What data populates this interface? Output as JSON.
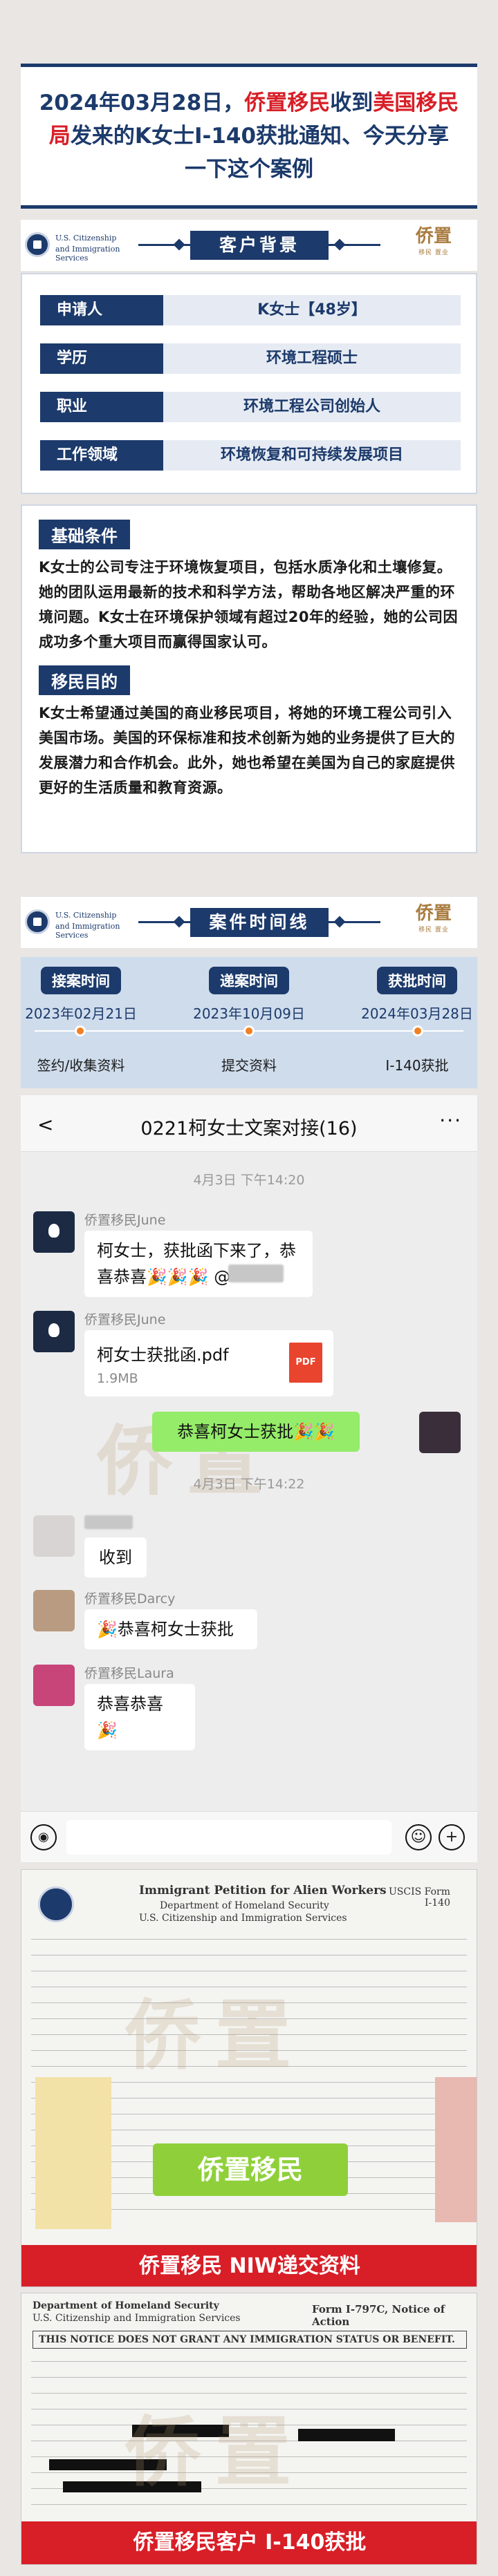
{
  "header": {
    "part1": "2024年03月28日，",
    "part2_red": "侨置移民",
    "part3": "收到",
    "part4_red": "美国移民局",
    "part5": "发来的K女士I-140获批通知、今天分享一下这个案例"
  },
  "logos": {
    "uscis_line1": "U.S. Citizenship",
    "uscis_line2": "and Immigration",
    "uscis_line3": "Services",
    "brand_name": "侨置",
    "brand_sub": "移民 置业"
  },
  "section_background": {
    "title": "客户背景"
  },
  "info": [
    {
      "label": "申请人",
      "value": "K女士【48岁】"
    },
    {
      "label": "学历",
      "value": "环境工程硕士"
    },
    {
      "label": "职业",
      "value": "环境工程公司创始人"
    },
    {
      "label": "工作领域",
      "value": "环境恢复和可持续发展项目"
    }
  ],
  "basic": {
    "label": "基础条件",
    "text": "K女士的公司专注于环境恢复项目，包括水质净化和土壤修复。她的团队运用最新的技术和科学方法，帮助各地区解决严重的环境问题。K女士在环境保护领域有超过20年的经验，她的公司因成功多个重大项目而赢得国家认可。"
  },
  "purpose": {
    "label": "移民目的",
    "text": "K女士希望通过美国的商业移民项目，将她的环境工程公司引入美国市场。美国的环保标准和技术创新为她的业务提供了巨大的发展潜力和合作机会。此外，她也希望在美国为自己的家庭提供更好的生活质量和教育资源。"
  },
  "section_timeline": {
    "title": "案件时间线"
  },
  "timeline": [
    {
      "label": "接案时间",
      "date": "2023年02月21日",
      "step": "签约/收集资料"
    },
    {
      "label": "递案时间",
      "date": "2023年10月09日",
      "step": "提交资料"
    },
    {
      "label": "获批时间",
      "date": "2024年03月28日",
      "step": "I-140获批"
    }
  ],
  "chat": {
    "title": "0221柯女士文案对接(16)",
    "back_icon": "<",
    "more_icon": "···",
    "time1": "4月3日 下午14:20",
    "msg1_user": "侨置移民June",
    "msg1_text": "柯女士，获批函下来了，恭喜恭喜🎉🎉🎉 @",
    "msg2_user": "侨置移民June",
    "file_name": "柯女士获批函.pdf",
    "file_size": "1.9MB",
    "file_type": "PDF",
    "msg3_text": "恭喜柯女士获批🎉🎉",
    "time2": "4月3日 下午14:22",
    "msg4_text": "收到",
    "msg5_user": "侨置移民Darcy",
    "msg5_text": "🎉恭喜柯女士获批",
    "msg6_user": "侨置移民Laura",
    "msg6_text": "恭喜恭喜🎉"
  },
  "doc1": {
    "title": "Immigrant Petition for Alien Workers",
    "dept": "Department of Homeland Security",
    "agency": "U.S. Citizenship and Immigration Services",
    "form": "USCIS Form I-140",
    "green_tag": "侨置移民",
    "caption": "侨置移民 NIW递交资料"
  },
  "doc2": {
    "dept": "Department of Homeland Security",
    "agency": "U.S. Citizenship and Immigration Services",
    "form": "Form I-797C, Notice of Action",
    "notice": "THIS NOTICE DOES NOT GRANT ANY IMMIGRATION STATUS OR BENEFIT.",
    "caption": "侨置移民客户 I-140获批"
  }
}
